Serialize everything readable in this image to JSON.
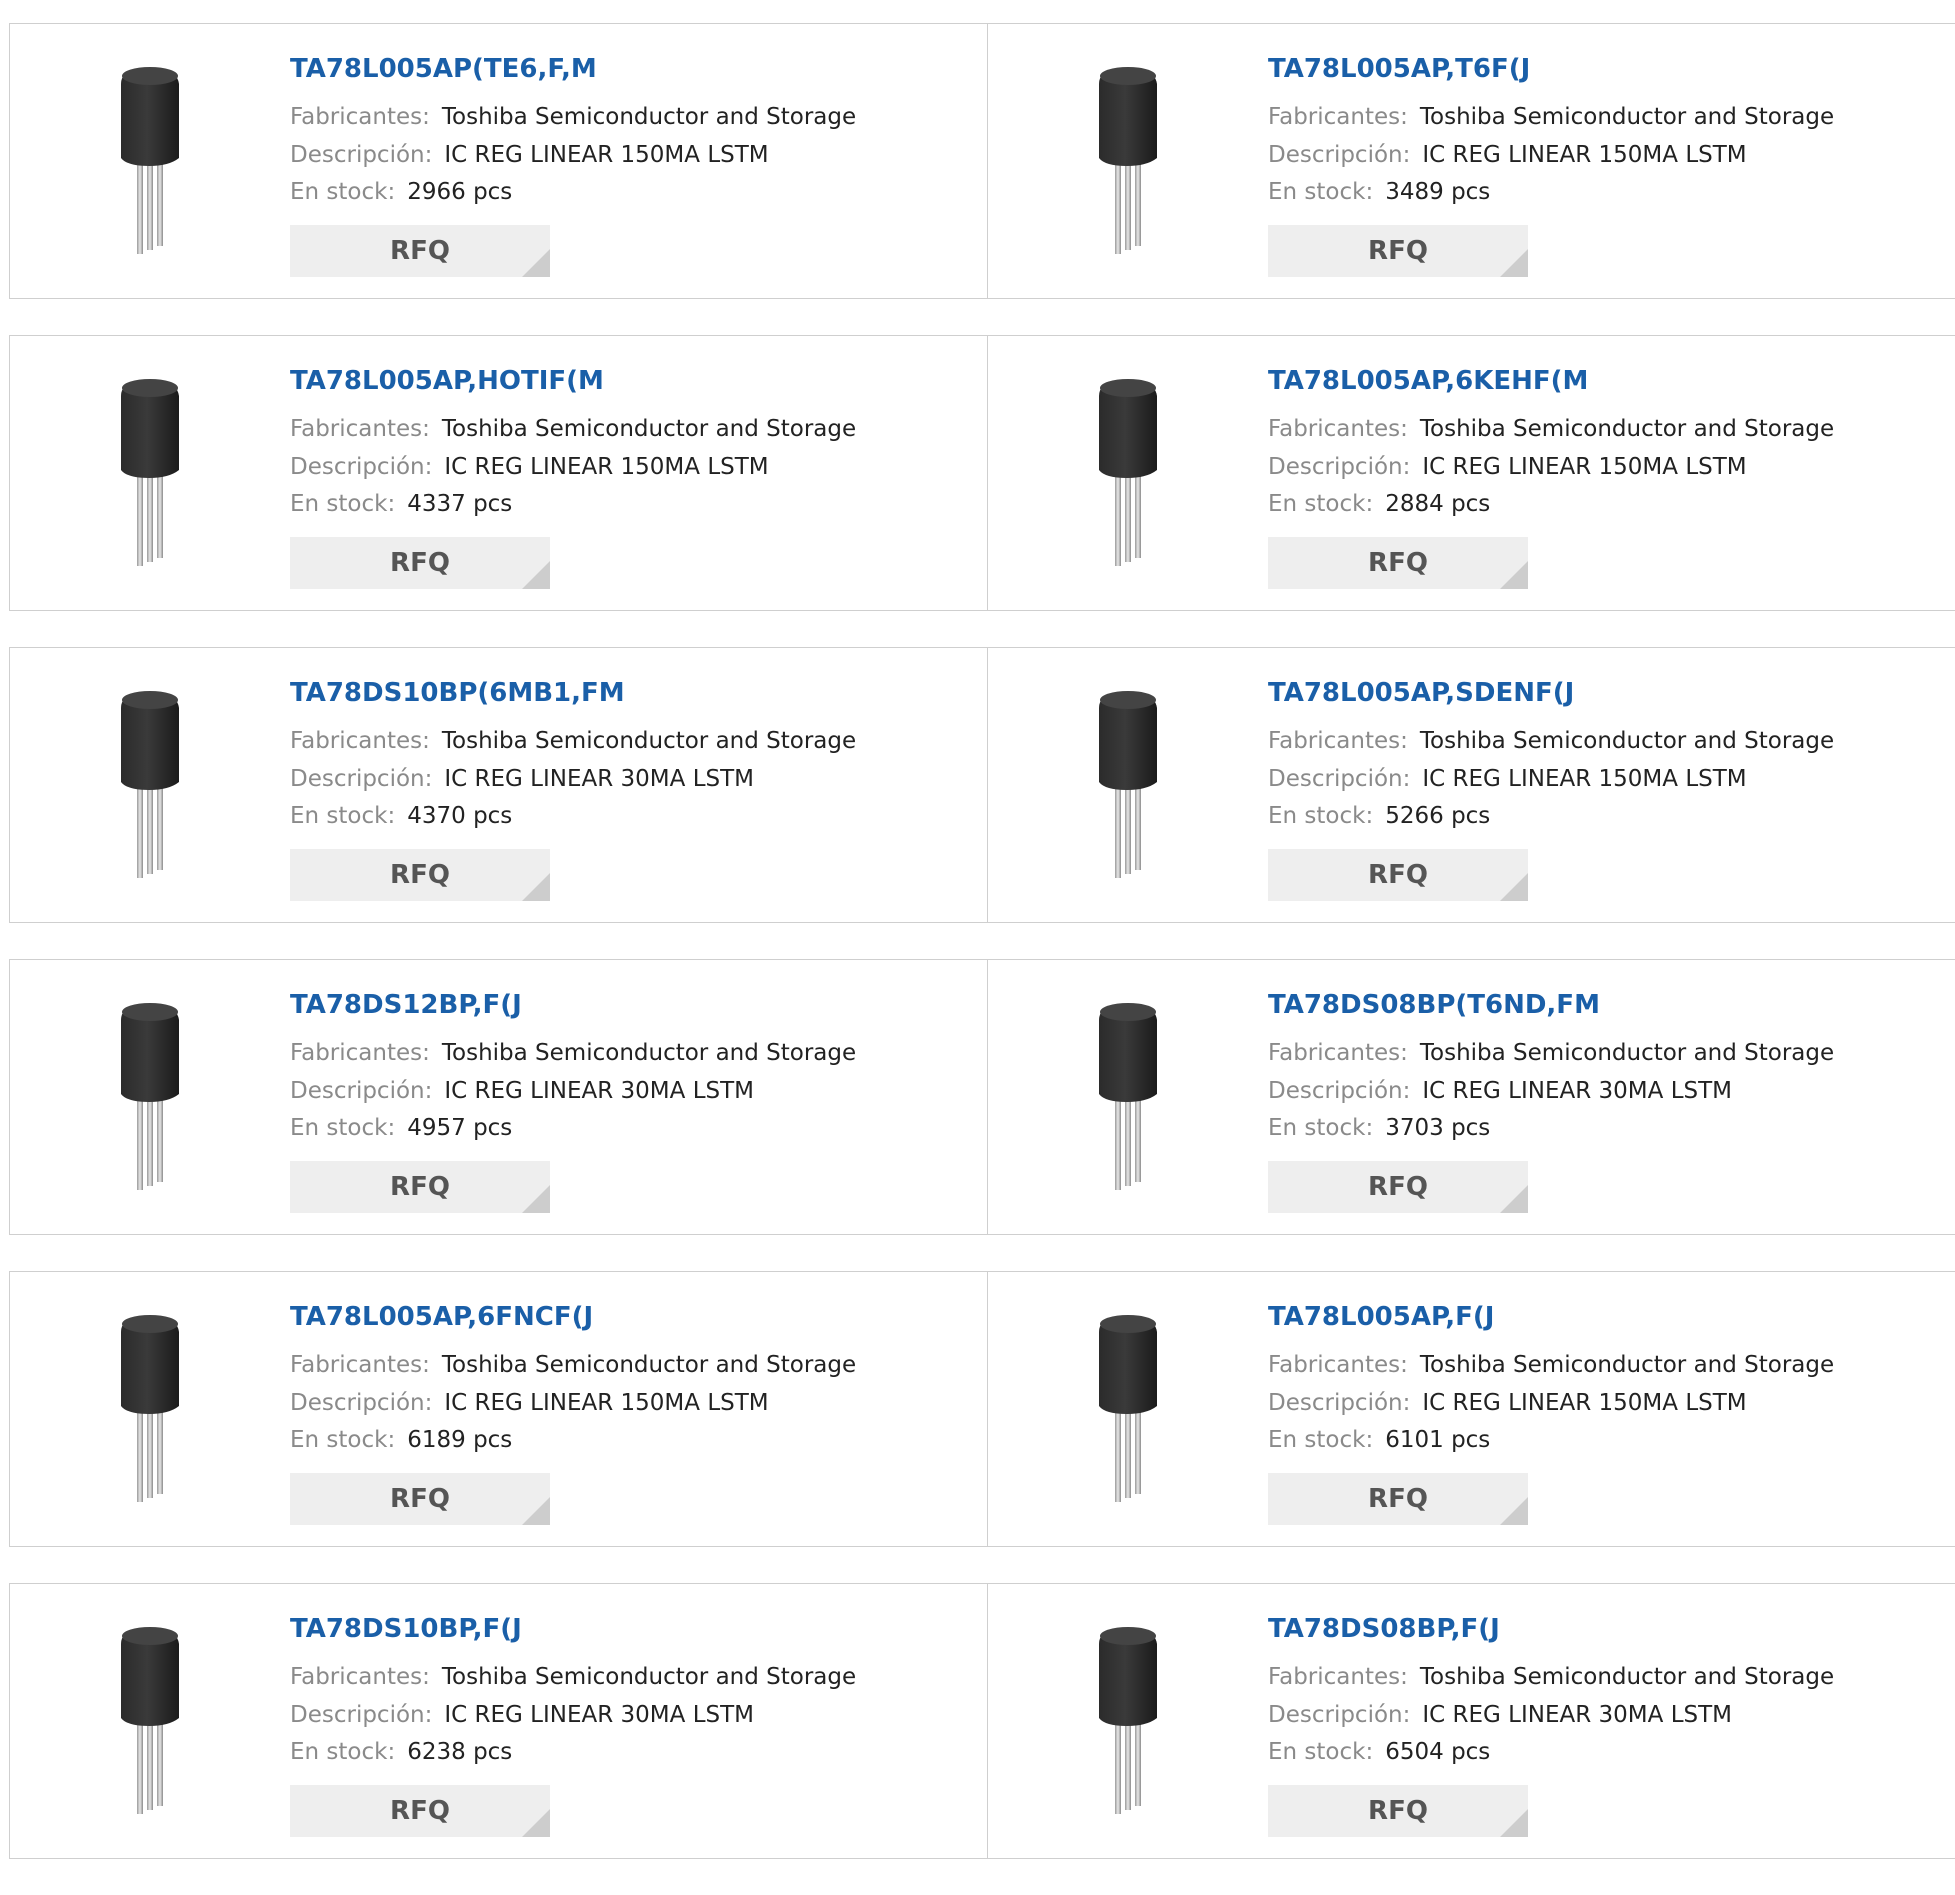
{
  "labels": {
    "manufacturer": "Fabricantes:",
    "description": "Descripción:",
    "stock": "En stock:",
    "rfq": "RFQ"
  },
  "image_icon": "to-92-transistor-package",
  "colors": {
    "part_link": "#1a5fa8",
    "label": "#8a8a8a",
    "rfq_bg": "#eeeeee"
  },
  "products": [
    {
      "part": "TA78L005AP(TE6,F,M",
      "manufacturer": "Toshiba Semiconductor and Storage",
      "description": "IC REG LINEAR 150MA LSTM",
      "stock": "2966 pcs"
    },
    {
      "part": "TA78L005AP,T6F(J",
      "manufacturer": "Toshiba Semiconductor and Storage",
      "description": "IC REG LINEAR 150MA LSTM",
      "stock": "3489 pcs"
    },
    {
      "part": "TA78L005AP,HOTIF(M",
      "manufacturer": "Toshiba Semiconductor and Storage",
      "description": "IC REG LINEAR 150MA LSTM",
      "stock": "4337 pcs"
    },
    {
      "part": "TA78L005AP,6KEHF(M",
      "manufacturer": "Toshiba Semiconductor and Storage",
      "description": "IC REG LINEAR 150MA LSTM",
      "stock": "2884 pcs"
    },
    {
      "part": "TA78DS10BP(6MB1,FM",
      "manufacturer": "Toshiba Semiconductor and Storage",
      "description": "IC REG LINEAR 30MA LSTM",
      "stock": "4370 pcs"
    },
    {
      "part": "TA78L005AP,SDENF(J",
      "manufacturer": "Toshiba Semiconductor and Storage",
      "description": "IC REG LINEAR 150MA LSTM",
      "stock": "5266 pcs"
    },
    {
      "part": "TA78DS12BP,F(J",
      "manufacturer": "Toshiba Semiconductor and Storage",
      "description": "IC REG LINEAR 30MA LSTM",
      "stock": "4957 pcs"
    },
    {
      "part": "TA78DS08BP(T6ND,FM",
      "manufacturer": "Toshiba Semiconductor and Storage",
      "description": "IC REG LINEAR 30MA LSTM",
      "stock": "3703 pcs"
    },
    {
      "part": "TA78L005AP,6FNCF(J",
      "manufacturer": "Toshiba Semiconductor and Storage",
      "description": "IC REG LINEAR 150MA LSTM",
      "stock": "6189 pcs"
    },
    {
      "part": "TA78L005AP,F(J",
      "manufacturer": "Toshiba Semiconductor and Storage",
      "description": "IC REG LINEAR 150MA LSTM",
      "stock": "6101 pcs"
    },
    {
      "part": "TA78DS10BP,F(J",
      "manufacturer": "Toshiba Semiconductor and Storage",
      "description": "IC REG LINEAR 30MA LSTM",
      "stock": "6238 pcs"
    },
    {
      "part": "TA78DS08BP,F(J",
      "manufacturer": "Toshiba Semiconductor and Storage",
      "description": "IC REG LINEAR 30MA LSTM",
      "stock": "6504 pcs"
    }
  ]
}
